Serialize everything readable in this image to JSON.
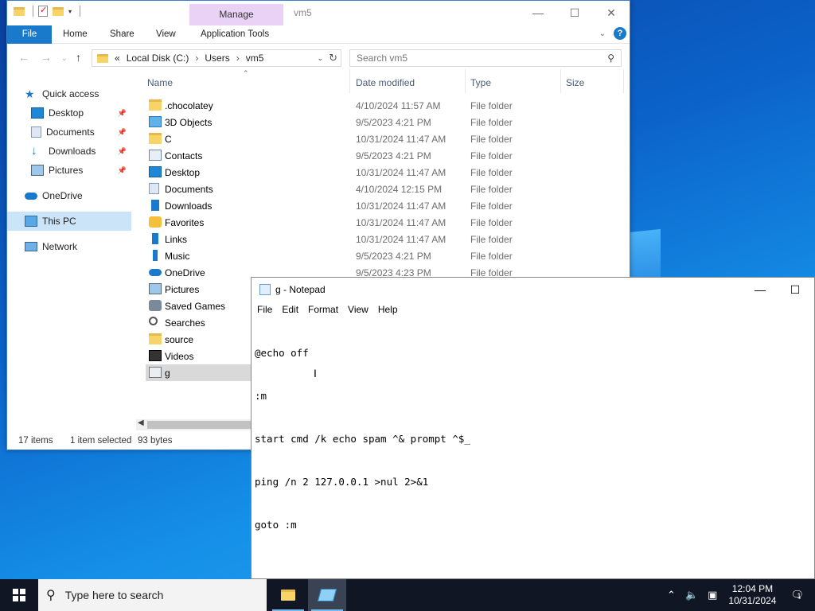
{
  "explorer": {
    "title": "vm5",
    "manage_tab": "Manage",
    "ribbon_tabs": [
      "File",
      "Home",
      "Share",
      "View",
      "Application Tools"
    ],
    "address": {
      "prefix": "«",
      "crumbs": [
        "Local Disk (C:)",
        "Users",
        "vm5"
      ]
    },
    "search_placeholder": "Search vm5",
    "nav": [
      {
        "label": "Quick access",
        "icon": "star-icon"
      },
      {
        "label": "Desktop",
        "icon": "desktop-icon",
        "pinned": true
      },
      {
        "label": "Documents",
        "icon": "documents-icon",
        "pinned": true
      },
      {
        "label": "Downloads",
        "icon": "downloads-icon",
        "pinned": true
      },
      {
        "label": "Pictures",
        "icon": "pictures-icon",
        "pinned": true
      },
      {
        "label": "OneDrive",
        "icon": "cloud-icon"
      },
      {
        "label": "This PC",
        "icon": "computer-icon",
        "selected": true
      },
      {
        "label": "Network",
        "icon": "network-icon"
      }
    ],
    "columns": {
      "name": "Name",
      "date": "Date modified",
      "type": "Type",
      "size": "Size"
    },
    "files": [
      {
        "name": ".chocolatey",
        "date": "4/10/2024 11:57 AM",
        "type": "File folder",
        "icon": "folder-icon"
      },
      {
        "name": "3D Objects",
        "date": "9/5/2023 4:21 PM",
        "type": "File folder",
        "icon": "3d-objects-icon"
      },
      {
        "name": "C",
        "date": "10/31/2024 11:47 AM",
        "type": "File folder",
        "icon": "folder-icon"
      },
      {
        "name": "Contacts",
        "date": "9/5/2023 4:21 PM",
        "type": "File folder",
        "icon": "contacts-icon"
      },
      {
        "name": "Desktop",
        "date": "10/31/2024 11:47 AM",
        "type": "File folder",
        "icon": "desktop-icon"
      },
      {
        "name": "Documents",
        "date": "4/10/2024 12:15 PM",
        "type": "File folder",
        "icon": "documents-icon"
      },
      {
        "name": "Downloads",
        "date": "10/31/2024 11:47 AM",
        "type": "File folder",
        "icon": "downloads-icon"
      },
      {
        "name": "Favorites",
        "date": "10/31/2024 11:47 AM",
        "type": "File folder",
        "icon": "star-icon"
      },
      {
        "name": "Links",
        "date": "10/31/2024 11:47 AM",
        "type": "File folder",
        "icon": "links-icon"
      },
      {
        "name": "Music",
        "date": "9/5/2023 4:21 PM",
        "type": "File folder",
        "icon": "music-icon"
      },
      {
        "name": "OneDrive",
        "date": "9/5/2023 4:23 PM",
        "type": "File folder",
        "icon": "cloud-icon"
      },
      {
        "name": "Pictures",
        "date": "",
        "type": "",
        "icon": "pictures-icon"
      },
      {
        "name": "Saved Games",
        "date": "",
        "type": "",
        "icon": "saved-games-icon"
      },
      {
        "name": "Searches",
        "date": "",
        "type": "",
        "icon": "search-icon"
      },
      {
        "name": "source",
        "date": "",
        "type": "",
        "icon": "folder-icon"
      },
      {
        "name": "Videos",
        "date": "",
        "type": "",
        "icon": "videos-icon"
      },
      {
        "name": "g",
        "date": "",
        "type": "",
        "icon": "batch-file-icon",
        "selected": true
      }
    ],
    "status": {
      "count": "17 items",
      "selected": "1 item selected",
      "size": "93 bytes"
    }
  },
  "notepad": {
    "title": "g - Notepad",
    "menu": [
      "File",
      "Edit",
      "Format",
      "View",
      "Help"
    ],
    "lines": [
      "@echo off",
      ":m",
      "start cmd /k echo spam ^& prompt ^$_",
      "ping /n 2 127.0.0.1 >nul 2>&1",
      "goto :m"
    ]
  },
  "taskbar": {
    "search_placeholder": "Type here to search",
    "time": "12:04 PM",
    "date": "10/31/2024",
    "notification_count": "1"
  },
  "colors": {
    "accent": "#1979ca",
    "manage_tab": "#ead2f7",
    "taskbar": "#101623"
  }
}
